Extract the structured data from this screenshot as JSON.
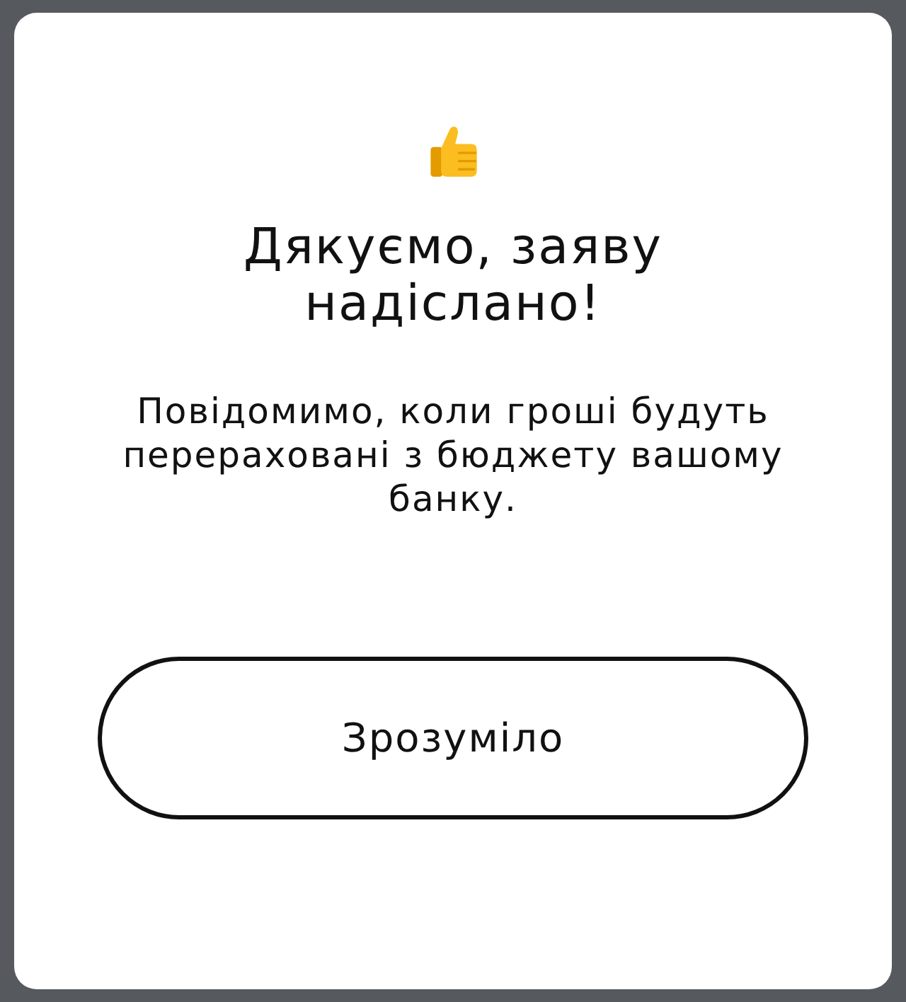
{
  "dialog": {
    "title": "Дякуємо, заяву надіслано!",
    "message": "Повідомимо, коли гроші будуть перераховані з бюджету вашому банку.",
    "button": "Зрозуміло"
  }
}
